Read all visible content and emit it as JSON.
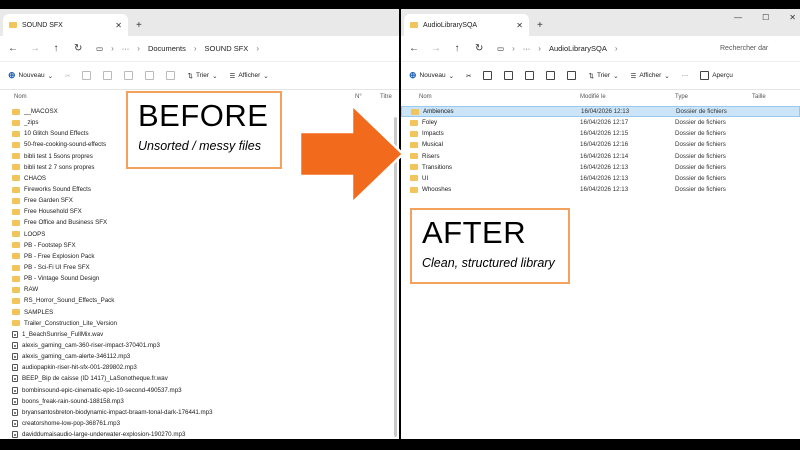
{
  "left": {
    "tab_title": "SOUND SFX",
    "breadcrumb": [
      "Documents",
      "SOUND SFX"
    ],
    "search_placeholder": "Rechercher dar",
    "toolbar": {
      "new": "Nouveau",
      "sort": "Trier",
      "view": "Afficher"
    },
    "columns": [
      "Nom",
      "N°",
      "Titre"
    ],
    "items": [
      {
        "name": "__MACOSX",
        "type": "folder"
      },
      {
        "name": "_zips",
        "type": "folder"
      },
      {
        "name": "10 Glitch Sound Effects",
        "type": "folder"
      },
      {
        "name": "50-free-cooking-sound-effects",
        "type": "folder"
      },
      {
        "name": "bibli test 1 5sons propres",
        "type": "folder"
      },
      {
        "name": "bibli test 2 7 sons propres",
        "type": "folder"
      },
      {
        "name": "CHAOS",
        "type": "folder"
      },
      {
        "name": "Fireworks Sound Effects",
        "type": "folder"
      },
      {
        "name": "Free Garden SFX",
        "type": "folder"
      },
      {
        "name": "Free Household SFX",
        "type": "folder"
      },
      {
        "name": "Free Office and Business SFX",
        "type": "folder"
      },
      {
        "name": "LOOPS",
        "type": "folder"
      },
      {
        "name": "PB - Footstep SFX",
        "type": "folder"
      },
      {
        "name": "PB - Free Explosion Pack",
        "type": "folder"
      },
      {
        "name": "PB - Sci-Fi UI Free SFX",
        "type": "folder"
      },
      {
        "name": "PB - Vintage Sound Design",
        "type": "folder"
      },
      {
        "name": "RAW",
        "type": "folder"
      },
      {
        "name": "RS_Horror_Sound_Effects_Pack",
        "type": "folder"
      },
      {
        "name": "SAMPLES",
        "type": "folder"
      },
      {
        "name": "Trailer_Construction_Lite_Version",
        "type": "folder"
      },
      {
        "name": "1_BeachSunrise_FullMix.wav",
        "type": "audio"
      },
      {
        "name": "alexis_gaming_cam-360-riser-impact-370401.mp3",
        "type": "audio"
      },
      {
        "name": "alexis_gaming_cam-alerte-346112.mp3",
        "type": "audio"
      },
      {
        "name": "audiopapkin-riser-hit-sfx-001-289802.mp3",
        "type": "audio"
      },
      {
        "name": "BEEP_Bip de caisse (ID 1417)_LaSonotheque.fr.wav",
        "type": "audio"
      },
      {
        "name": "bombinsound-epic-cinematic-epic-10-second-490537.mp3",
        "type": "audio"
      },
      {
        "name": "boons_freak-rain-sound-188158.mp3",
        "type": "audio"
      },
      {
        "name": "bryansantosbreton-biodynamic-impact-braam-tonal-dark-176441.mp3",
        "type": "audio"
      },
      {
        "name": "creatorshome-low-pop-368761.mp3",
        "type": "audio"
      },
      {
        "name": "daviddumaisaudio-large-underwater-explosion-190270.mp3",
        "type": "audio"
      }
    ]
  },
  "right": {
    "tab_title": "AudioLibrarySQA",
    "breadcrumb": [
      "AudioLibrarySQA"
    ],
    "search_placeholder": "Rechercher dar",
    "toolbar": {
      "new": "Nouveau",
      "sort": "Trier",
      "view": "Afficher",
      "preview": "Aperçu"
    },
    "columns": [
      "Nom",
      "Modifié le",
      "Type",
      "Taille"
    ],
    "items": [
      {
        "name": "Ambiences",
        "date": "16/04/2026 12:13",
        "type": "Dossier de fichiers",
        "selected": true
      },
      {
        "name": "Foley",
        "date": "16/04/2026 12:17",
        "type": "Dossier de fichiers"
      },
      {
        "name": "Impacts",
        "date": "16/04/2026 12:15",
        "type": "Dossier de fichiers"
      },
      {
        "name": "Musical",
        "date": "16/04/2026 12:16",
        "type": "Dossier de fichiers"
      },
      {
        "name": "Risers",
        "date": "16/04/2026 12:14",
        "type": "Dossier de fichiers"
      },
      {
        "name": "Transitions",
        "date": "16/04/2026 12:13",
        "type": "Dossier de fichiers"
      },
      {
        "name": "UI",
        "date": "16/04/2026 12:13",
        "type": "Dossier de fichiers"
      },
      {
        "name": "Whooshes",
        "date": "16/04/2026 12:13",
        "type": "Dossier de fichiers"
      }
    ]
  },
  "callouts": {
    "before_title": "BEFORE",
    "before_sub": "Unsorted / messy files",
    "after_title": "AFTER",
    "after_sub": "Clean, structured library"
  },
  "colors": {
    "arrow": "#f26b1d",
    "callout_border": "#f2a25c",
    "folder": "#f2c55c",
    "selection": "#cce4f7"
  }
}
